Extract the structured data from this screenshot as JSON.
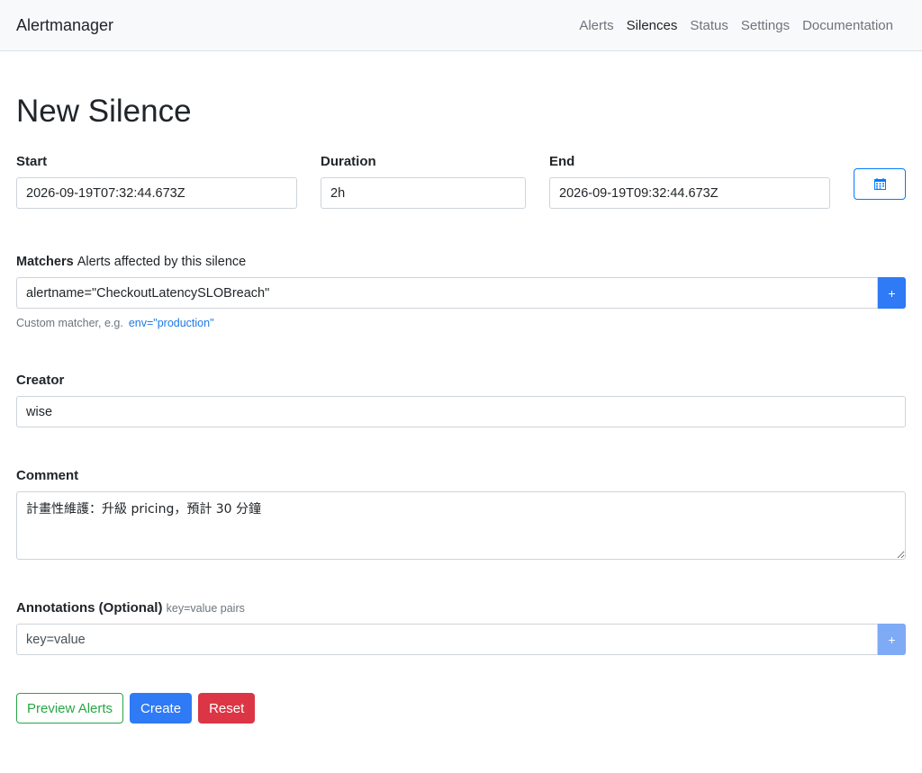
{
  "navbar": {
    "brand": "Alertmanager",
    "links": [
      "Alerts",
      "Silences",
      "Status",
      "Settings",
      "Documentation"
    ],
    "active": "Silences"
  },
  "page": {
    "title": "New Silence"
  },
  "times": {
    "start_label": "Start",
    "start_value": "2026-09-19T07:32:44.673Z",
    "duration_label": "Duration",
    "duration_value": "2h",
    "end_label": "End",
    "end_value": "2026-09-19T09:32:44.673Z",
    "calendar_icon": "calendar-icon"
  },
  "matchers": {
    "label": "Matchers",
    "sublabel": "Alerts affected by this silence",
    "value": "alertname=\"CheckoutLatencySLOBreach\"",
    "add_label": "+",
    "hint": "Custom matcher, e.g.",
    "hint_example": "env=\"production\""
  },
  "creator": {
    "label": "Creator",
    "value": "wise"
  },
  "comment": {
    "label": "Comment",
    "value": "計畫性維護：升級 pricing，預計 30 分鐘"
  },
  "annotations": {
    "label": "Annotations (Optional)",
    "sublabel": "key=value pairs",
    "placeholder": "key=value",
    "add_label": "+"
  },
  "actions": {
    "preview": "Preview Alerts",
    "create": "Create",
    "reset": "Reset"
  },
  "colors": {
    "primary": "#2f7af5",
    "success": "#28a745",
    "danger": "#dc3545"
  }
}
